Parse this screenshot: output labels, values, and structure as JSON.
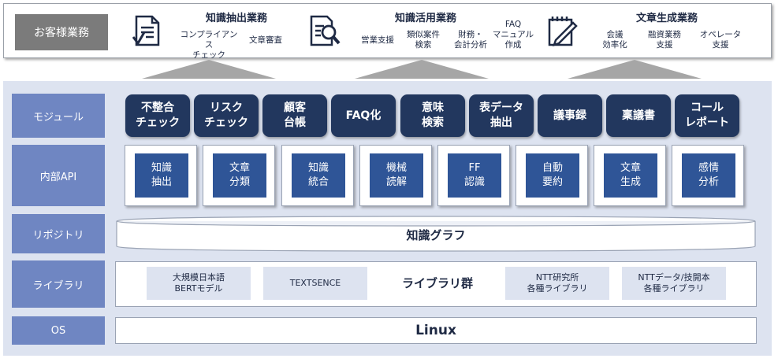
{
  "customer": "お客様業務",
  "business": [
    {
      "title": "知識抽出業務",
      "icon": "document-check-icon",
      "subs": [
        "コンプライアンス\nチェック",
        "文章審査"
      ]
    },
    {
      "title": "知識活用業務",
      "icon": "document-search-icon",
      "subs": [
        "営業支援",
        "類似案件\n検索",
        "財務・\n会計分析",
        "FAQ\nマニュアル\n作成"
      ]
    },
    {
      "title": "文章生成業務",
      "icon": "pen-writing-icon",
      "subs": [
        "会議\n効率化",
        "融資業務\n支援",
        "オペレータ\n支援"
      ]
    }
  ],
  "layers": {
    "module": "モジュール",
    "api": "内部API",
    "repository": "リポジトリ",
    "library": "ライブラリ",
    "os": "OS"
  },
  "modules": [
    "不整合\nチェック",
    "リスク\nチェック",
    "顧客\n台帳",
    "FAQ化",
    "意味\n検索",
    "表データ\n抽出",
    "議事録",
    "稟議書",
    "コール\nレポート"
  ],
  "apis": [
    "知識\n抽出",
    "文章\n分類",
    "知識\n統合",
    "機械\n読解",
    "FF\n認識",
    "自動\n要約",
    "文章\n生成",
    "感情\n分析"
  ],
  "repository": "知識グラフ",
  "libraries": {
    "items": [
      "大規模日本語\nBERTモデル",
      "TEXTSENCE",
      "NTT研究所\n各種ライブラリ",
      "NTTデータ/技開本\n各種ライブラリ"
    ],
    "center": "ライブラリ群"
  },
  "os": "Linux",
  "colors": {
    "module_bg": "#22375e",
    "api_bg": "#2f5597",
    "layer_label_bg": "#6f86c2",
    "platform_bg": "#dde3f0",
    "customer_bg": "#7b7b7b"
  }
}
